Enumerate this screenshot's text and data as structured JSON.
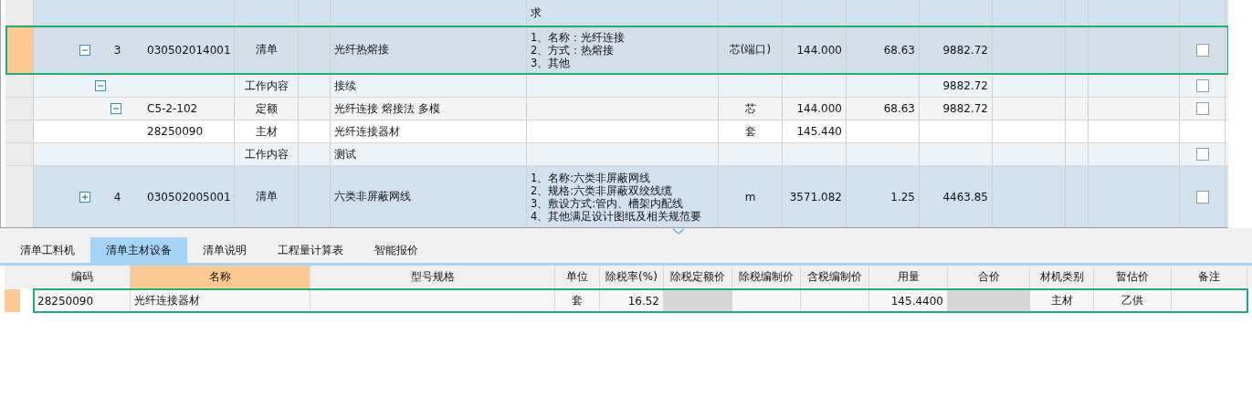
{
  "bill_grid": {
    "rows": [
      {
        "kind": "bill",
        "selected": false,
        "features": [
          "求"
        ]
      },
      {
        "kind": "bill",
        "selected": true,
        "expanded": true,
        "number": "3",
        "code": "030502014001",
        "type": "清单",
        "name": "光纤热熔接",
        "features": [
          "1、名称：光纤连接",
          "2、方式：热熔接",
          "3、其他"
        ],
        "unit": "芯(端口)",
        "quantity": "144.000",
        "price": "68.63",
        "total": "9882.72",
        "checked": false,
        "children": [
          {
            "kind": "work",
            "selected": false,
            "expanded": true,
            "type": "工作内容",
            "name": "接续",
            "total": "9882.72",
            "checked": false,
            "children": [
              {
                "kind": "quota",
                "selected": false,
                "expanded": true,
                "code": "C5-2-102",
                "type": "定额",
                "name": "光纤连接 熔接法 多模",
                "unit": "芯",
                "quantity": "144.000",
                "price": "68.63",
                "total": "9882.72",
                "checked": false,
                "children": [
                  {
                    "kind": "material",
                    "selected": false,
                    "code": "28250090",
                    "type": "主材",
                    "name": "光纤连接器材",
                    "unit": "套",
                    "quantity": "145.440"
                  }
                ]
              }
            ]
          },
          {
            "kind": "work",
            "selected": false,
            "type": "工作内容",
            "name": "测试",
            "checked": false
          }
        ]
      },
      {
        "kind": "bill",
        "selected": false,
        "expanded": false,
        "number": "4",
        "code": "030502005001",
        "type": "清单",
        "name": "六类非屏蔽网线",
        "features": [
          "1、名称:六类非屏蔽网线",
          "2、规格:六类非屏蔽双绞线缆",
          "3、敷设方式:管内、槽架内配线",
          "4、其他满足设计图纸及相关规范要"
        ],
        "unit": "m",
        "quantity": "3571.082",
        "price": "1.25",
        "total": "4463.85",
        "checked": false
      }
    ]
  },
  "tabs": [
    {
      "label": "清单工料机",
      "selected": false
    },
    {
      "label": "清单主材设备",
      "selected": true
    },
    {
      "label": "清单说明",
      "selected": false
    },
    {
      "label": "工程量计算表",
      "selected": false
    },
    {
      "label": "智能报价",
      "selected": false
    }
  ],
  "material_table": {
    "columns": [
      {
        "label": "编码",
        "selected": false
      },
      {
        "label": "名称",
        "selected": true
      },
      {
        "label": "型号规格",
        "selected": false
      },
      {
        "label": "单位",
        "selected": false
      },
      {
        "label": "除税率(%)",
        "selected": false
      },
      {
        "label": "除税定额价",
        "selected": false
      },
      {
        "label": "除税编制价",
        "selected": false
      },
      {
        "label": "含税编制价",
        "selected": false
      },
      {
        "label": "用量",
        "selected": false
      },
      {
        "label": "合价",
        "selected": false
      },
      {
        "label": "材机类别",
        "selected": false
      },
      {
        "label": "暂估价",
        "selected": false
      },
      {
        "label": "备注",
        "selected": false
      }
    ],
    "rows": [
      {
        "selected": true,
        "cells": [
          {
            "text": "28250090",
            "disabled": false
          },
          {
            "text": "光纤连接器材",
            "disabled": false
          },
          {
            "disabled": false
          },
          {
            "text": "套",
            "disabled": false
          },
          {
            "text": "16.52",
            "disabled": false
          },
          {
            "disabled": true
          },
          {
            "disabled": false
          },
          {
            "disabled": false
          },
          {
            "text": "145.4400",
            "disabled": false
          },
          {
            "disabled": true
          },
          {
            "text": "主材",
            "disabled": false
          },
          {
            "text": "乙供",
            "disabled": false
          },
          {
            "disabled": false
          }
        ]
      }
    ]
  }
}
